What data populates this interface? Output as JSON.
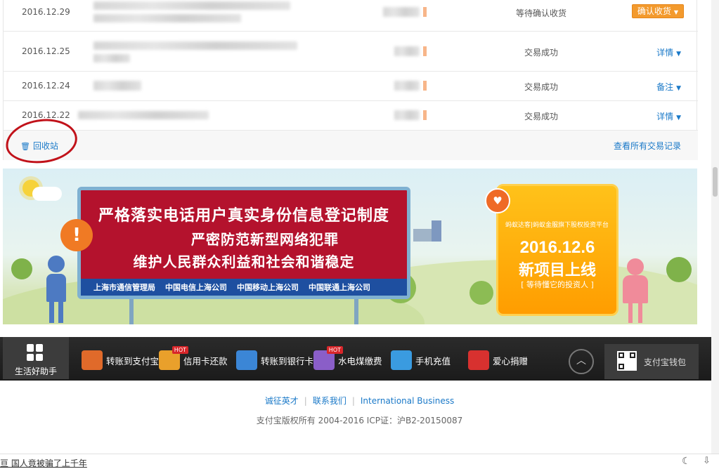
{
  "transactions": [
    {
      "date": "2016.12.29",
      "status": "等待确认收货",
      "action": "确认收货"
    },
    {
      "date": "2016.12.25",
      "status": "交易成功",
      "action": "详情"
    },
    {
      "date": "2016.12.24",
      "status": "交易成功",
      "action": "备注"
    },
    {
      "date": "2016.12.22",
      "status": "交易成功",
      "action": "详情"
    }
  ],
  "footer_panel": {
    "recycle": "回收站",
    "view_all": "查看所有交易记录"
  },
  "banner": {
    "line1": "严格落实电话用户真实身份信息登记制度",
    "line2": "严密防范新型网络犯罪",
    "line3": "维护人民群众利益和社会和谐稳定",
    "sponsors": [
      "上海市通信管理局",
      "中国电信上海公司",
      "中国移动上海公司",
      "中国联通上海公司"
    ],
    "bubble": "!",
    "promo_brand": "蚂蚁达客|蚂蚁金服旗下股权投资平台",
    "promo_date": "2016.12.6",
    "promo_title": "新项目上线",
    "promo_sub": "[ 等待懂它的投资人 ]"
  },
  "toolbar": {
    "home_label": "生活好助手",
    "items": [
      {
        "label": "转账到支付宝",
        "icon": "transfer-alipay-icon",
        "color": "#e06a2a"
      },
      {
        "label": "信用卡还款",
        "icon": "credit-card-icon",
        "color": "#e9a02b",
        "badge": "HOT"
      },
      {
        "label": "转账到银行卡",
        "icon": "bank-card-icon",
        "color": "#3b86d6"
      },
      {
        "label": "水电煤缴费",
        "icon": "utility-icon",
        "color": "#8a5ec8",
        "badge": "HOT"
      },
      {
        "label": "手机充值",
        "icon": "phone-icon",
        "color": "#3a9be0"
      },
      {
        "label": "爱心捐赠",
        "icon": "heart-icon",
        "color": "#d8312f"
      }
    ],
    "up_icon": "chevron-up-icon",
    "wallet_label": "支付宝钱包"
  },
  "footer": {
    "links": [
      "诚征英才",
      "联系我们",
      "International Business"
    ],
    "copyright": "支付宝版权所有 2004-2016 ICP证：沪B2-20150087"
  },
  "statusbar": {
    "news": "亘 国人竟被骗了上千年"
  }
}
